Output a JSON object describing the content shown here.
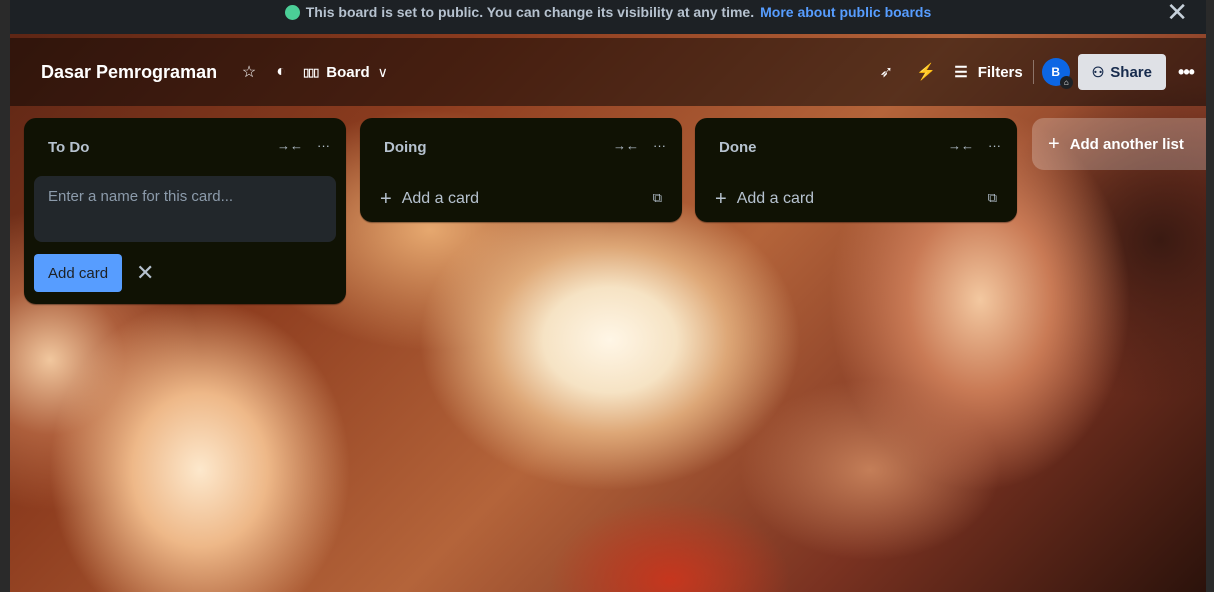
{
  "banner": {
    "text": "This board is set to public. You can change its visibility at any time.",
    "link": "More about public boards",
    "close_glyph": "✕"
  },
  "header": {
    "board_title": "Dasar Pemrograman",
    "star_glyph": "☆",
    "visibility_glyph": "◐",
    "view_icon": "▯▯▯",
    "view_label": "Board",
    "view_chevron": "∨",
    "power_ups_glyph": "➶",
    "automation_glyph": "⚡",
    "filters_glyph": "☰",
    "filters_label": "Filters",
    "avatar_initial": "B",
    "share_icon": "⚇",
    "share_label": "Share",
    "more_glyph": "•••"
  },
  "lists": [
    {
      "title": "To Do",
      "collapse_glyph": "→←",
      "menu_glyph": "···"
    },
    {
      "title": "Doing",
      "collapse_glyph": "→←",
      "menu_glyph": "···",
      "add_card_label": "Add a card",
      "plus_glyph": "+",
      "template_glyph": "⧉"
    },
    {
      "title": "Done",
      "collapse_glyph": "→←",
      "menu_glyph": "···",
      "add_card_label": "Add a card",
      "plus_glyph": "+",
      "template_glyph": "⧉"
    }
  ],
  "composer": {
    "placeholder": "Enter a name for this card...",
    "value": "",
    "submit_label": "Add card",
    "cancel_glyph": "✕"
  },
  "add_list": {
    "plus_glyph": "+",
    "label": "Add another list"
  },
  "colors": {
    "banner_bg": "#1d2125",
    "link": "#579dff",
    "list_bg": "#101204",
    "primary_button": "#579dff",
    "avatar_bg": "#0c66e4",
    "public_icon": "#4bce97"
  }
}
